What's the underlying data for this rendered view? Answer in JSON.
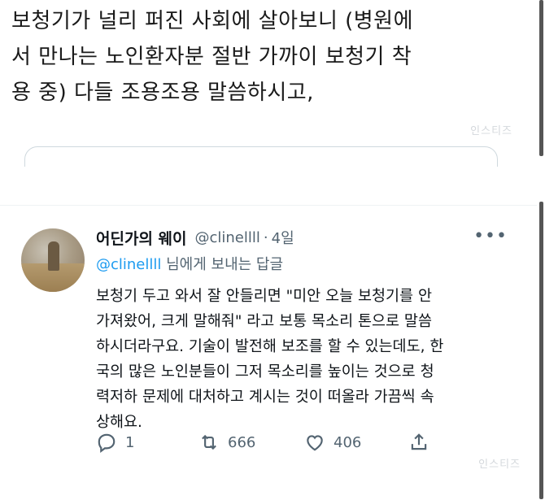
{
  "top_tweet": {
    "lines": [
      "보청기가 널리 퍼진 사회에 살아보니 (병원에",
      "서 만나는 노인환자분 절반 가까이 보청기 착",
      "용 중) 다들 조용조용 말씀하시고,"
    ]
  },
  "watermark": "인스티즈",
  "reply_tweet": {
    "display_name": "어딘가의 웨이",
    "handle": "@clinellll",
    "separator": "·",
    "time_ago": "4일",
    "more_icon": "more-dots-icon",
    "reply_to_mention": "@clinellll",
    "reply_to_suffix": " 님에게 보내는 답글",
    "body_lines": [
      "보청기 두고 와서 잘 안들리면 \"미안 오늘 보청기를 안",
      "가져왔어, 크게 말해줘\" 라고 보통 목소리 톤으로 말씀",
      "하시더라구요. 기술이 발전해 보조를 할 수 있는데도, 한",
      "국의 많은 노인분들이 그저 목소리를 높이는 것으로 청",
      "력저하 문제에 대처하고 계시는 것이 떠올라 가끔씩 속",
      "상해요."
    ],
    "actions": {
      "reply_count": "1",
      "retweet_count": "666",
      "like_count": "406"
    }
  },
  "colors": {
    "text": "#0f1419",
    "secondary": "#536471",
    "link": "#1d9bf0",
    "border": "#cfd9de"
  }
}
